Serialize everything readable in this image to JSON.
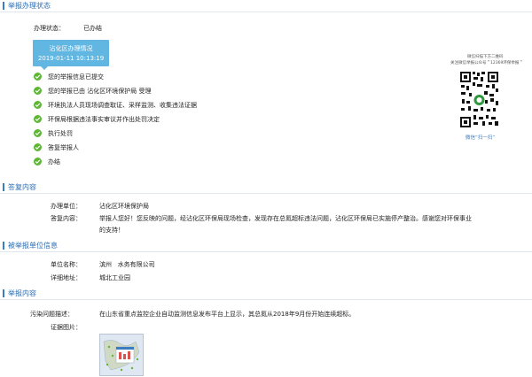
{
  "sections": {
    "status": "举报办理状态",
    "reply": "答复内容",
    "reported": "被举报单位信息",
    "report": "举报内容"
  },
  "status": {
    "label": "办理状态：",
    "value": "已办结"
  },
  "dept_box": {
    "name": "沾化区办理情况",
    "datetime": "2019-01-11 10:13:19"
  },
  "steps": [
    "您的举报信息已提交",
    "您的举报已由 沾化区环境保护局 受理",
    "环境执法人员现场调查取证、采样监测、收集违法证据",
    "环保局根据违法事实审议并作出处罚决定",
    "执行处罚",
    "答复举报人",
    "办结"
  ],
  "qr": {
    "caption_line1": "微信扫描下方二维码",
    "caption_line2": "关注微信举报公众号＂12369环保举报＂",
    "scan_label": "微信“扫一扫”"
  },
  "reply": {
    "unit_label": "办理单位：",
    "unit_value": "沾化区环境保护局",
    "content_label": "答复内容：",
    "content_line1": "举报人您好！您反映的问题，经沾化区环保局现场检查，发现存在总氮超标违法问题，沾化区环保局已实施停产整治。感谢您对环保事业",
    "content_line2": "的支持！"
  },
  "reported": {
    "name_label": "单位名称：",
    "name_value_a": "滨州",
    "name_value_b": "水务有限公司",
    "addr_label": "详细地址：",
    "addr_value": "城北工业园"
  },
  "report": {
    "problem_label": "污染问题描述：",
    "problem_value": "在山东省重点监控企业自动监测信息发布平台上显示，其总氮从2018年9月份开始连续超标。",
    "evidence_label": "证据图片："
  },
  "colors": {
    "accent": "#2a6db3",
    "dept_box": "#62b6e2",
    "check": "#5cb832"
  }
}
